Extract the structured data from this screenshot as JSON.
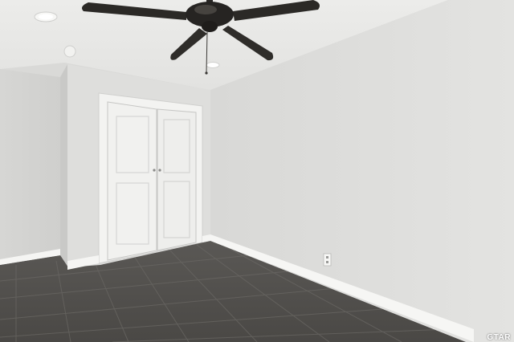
{
  "watermark": {
    "text": "GTAR"
  },
  "colors": {
    "ceiling": "#e9e9e7",
    "wall_right": "#dcdcda",
    "wall_left": "#d4d4d2",
    "floor_tile": "#54524f",
    "grout": "#6a6864",
    "baseboard": "#f4f4f2",
    "door": "#f0f0ee",
    "fan_metal": "#2a2826"
  },
  "scene": {
    "objects": [
      "ceiling-fan",
      "recessed-light",
      "closet-double-door",
      "electrical-outlet",
      "tile-floor",
      "baseboard"
    ]
  }
}
